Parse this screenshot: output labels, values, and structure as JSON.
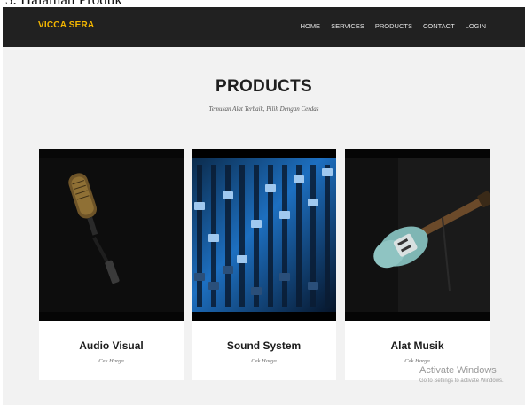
{
  "caption": "3. Halaman Produk",
  "brand": "VICCA SERA",
  "nav": [
    "HOME",
    "SERVICES",
    "PRODUCTS",
    "CONTACT",
    "LOGIN"
  ],
  "section": {
    "title": "PRODUCTS",
    "subtitle": "Temukan Alat Terbaik, Pilih Dengan Cerdas"
  },
  "products": [
    {
      "title": "Audio Visual",
      "link": "Cek Harga"
    },
    {
      "title": "Sound System",
      "link": "Cek Harga"
    },
    {
      "title": "Alat Musik",
      "link": "Cek Harga"
    }
  ],
  "watermark": {
    "line1": "Activate Windows",
    "line2": "Go to Settings to activate Windows."
  },
  "colors": {
    "navbar": "#212121",
    "brand": "#f5b700",
    "page": "#f2f2f2"
  }
}
